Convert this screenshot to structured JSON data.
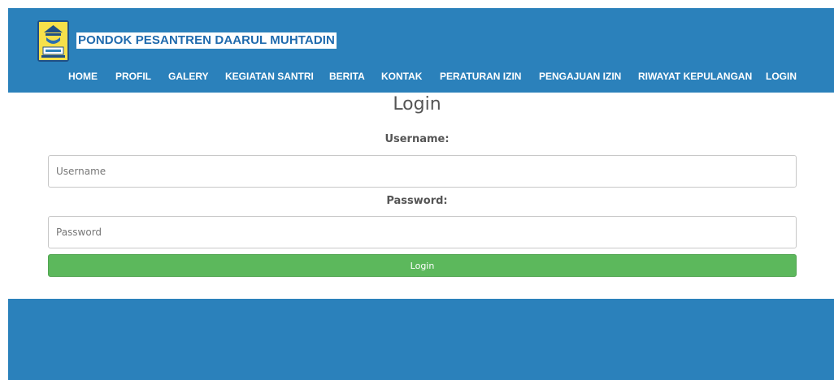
{
  "header": {
    "brand_title": "PONDOK PESANTREN DAARUL MUHTADIN",
    "logo_icon": "pesantren-emblem-icon",
    "bg_color": "#2b81bb"
  },
  "nav": {
    "items": [
      {
        "label": "HOME"
      },
      {
        "label": "PROFIL"
      },
      {
        "label": "GALERY"
      },
      {
        "label": "KEGIATAN SANTRI"
      },
      {
        "label": "BERITA"
      },
      {
        "label": "KONTAK"
      },
      {
        "label": "PERATURAN IZIN"
      },
      {
        "label": "PENGAJUAN IZIN"
      },
      {
        "label": "RIWAYAT KEPULANGAN"
      },
      {
        "label": "LOGIN"
      }
    ]
  },
  "login": {
    "title": "Login",
    "username_label": "Username:",
    "username_placeholder": "Username",
    "username_value": "",
    "password_label": "Password:",
    "password_placeholder": "Password",
    "password_value": "",
    "submit_label": "Login",
    "submit_color": "#5cb85c"
  }
}
